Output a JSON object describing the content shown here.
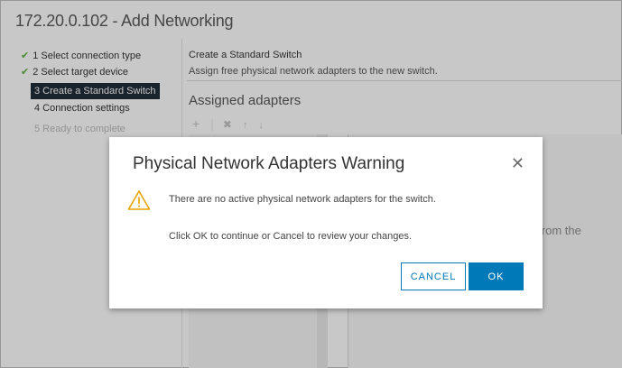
{
  "window": {
    "title": "172.20.0.102 - Add Networking"
  },
  "wizard": {
    "steps": [
      {
        "label": "1 Select connection type",
        "state": "done"
      },
      {
        "label": "2 Select target device",
        "state": "done"
      },
      {
        "label": "3 Create a Standard Switch",
        "state": "active"
      },
      {
        "label": "4 Connection settings",
        "state": "pending"
      },
      {
        "label": "5 Ready to complete",
        "state": "future"
      }
    ]
  },
  "pane": {
    "title": "Create a Standard Switch",
    "subtitle": "Assign free physical network adapters to the new switch.",
    "assigned_heading": "Assigned adapters",
    "background_text": "er from the"
  },
  "toolbar": {
    "add_icon": "plus-icon",
    "remove_icon": "remove-icon",
    "up_icon": "arrow-up-icon",
    "down_icon": "arrow-down-icon"
  },
  "dialog": {
    "title": "Physical Network Adapters Warning",
    "close_icon": "close-icon",
    "warning_icon": "warning-icon",
    "message": "There are no active physical network adapters for the switch.",
    "instruction": "Click OK to continue or Cancel to review your changes.",
    "cancel_label": "CANCEL",
    "ok_label": "OK"
  },
  "colors": {
    "accent": "#0079b8",
    "check": "#5aa83c",
    "warning": "#e5a400",
    "active_step_bg": "#1f2b36"
  }
}
